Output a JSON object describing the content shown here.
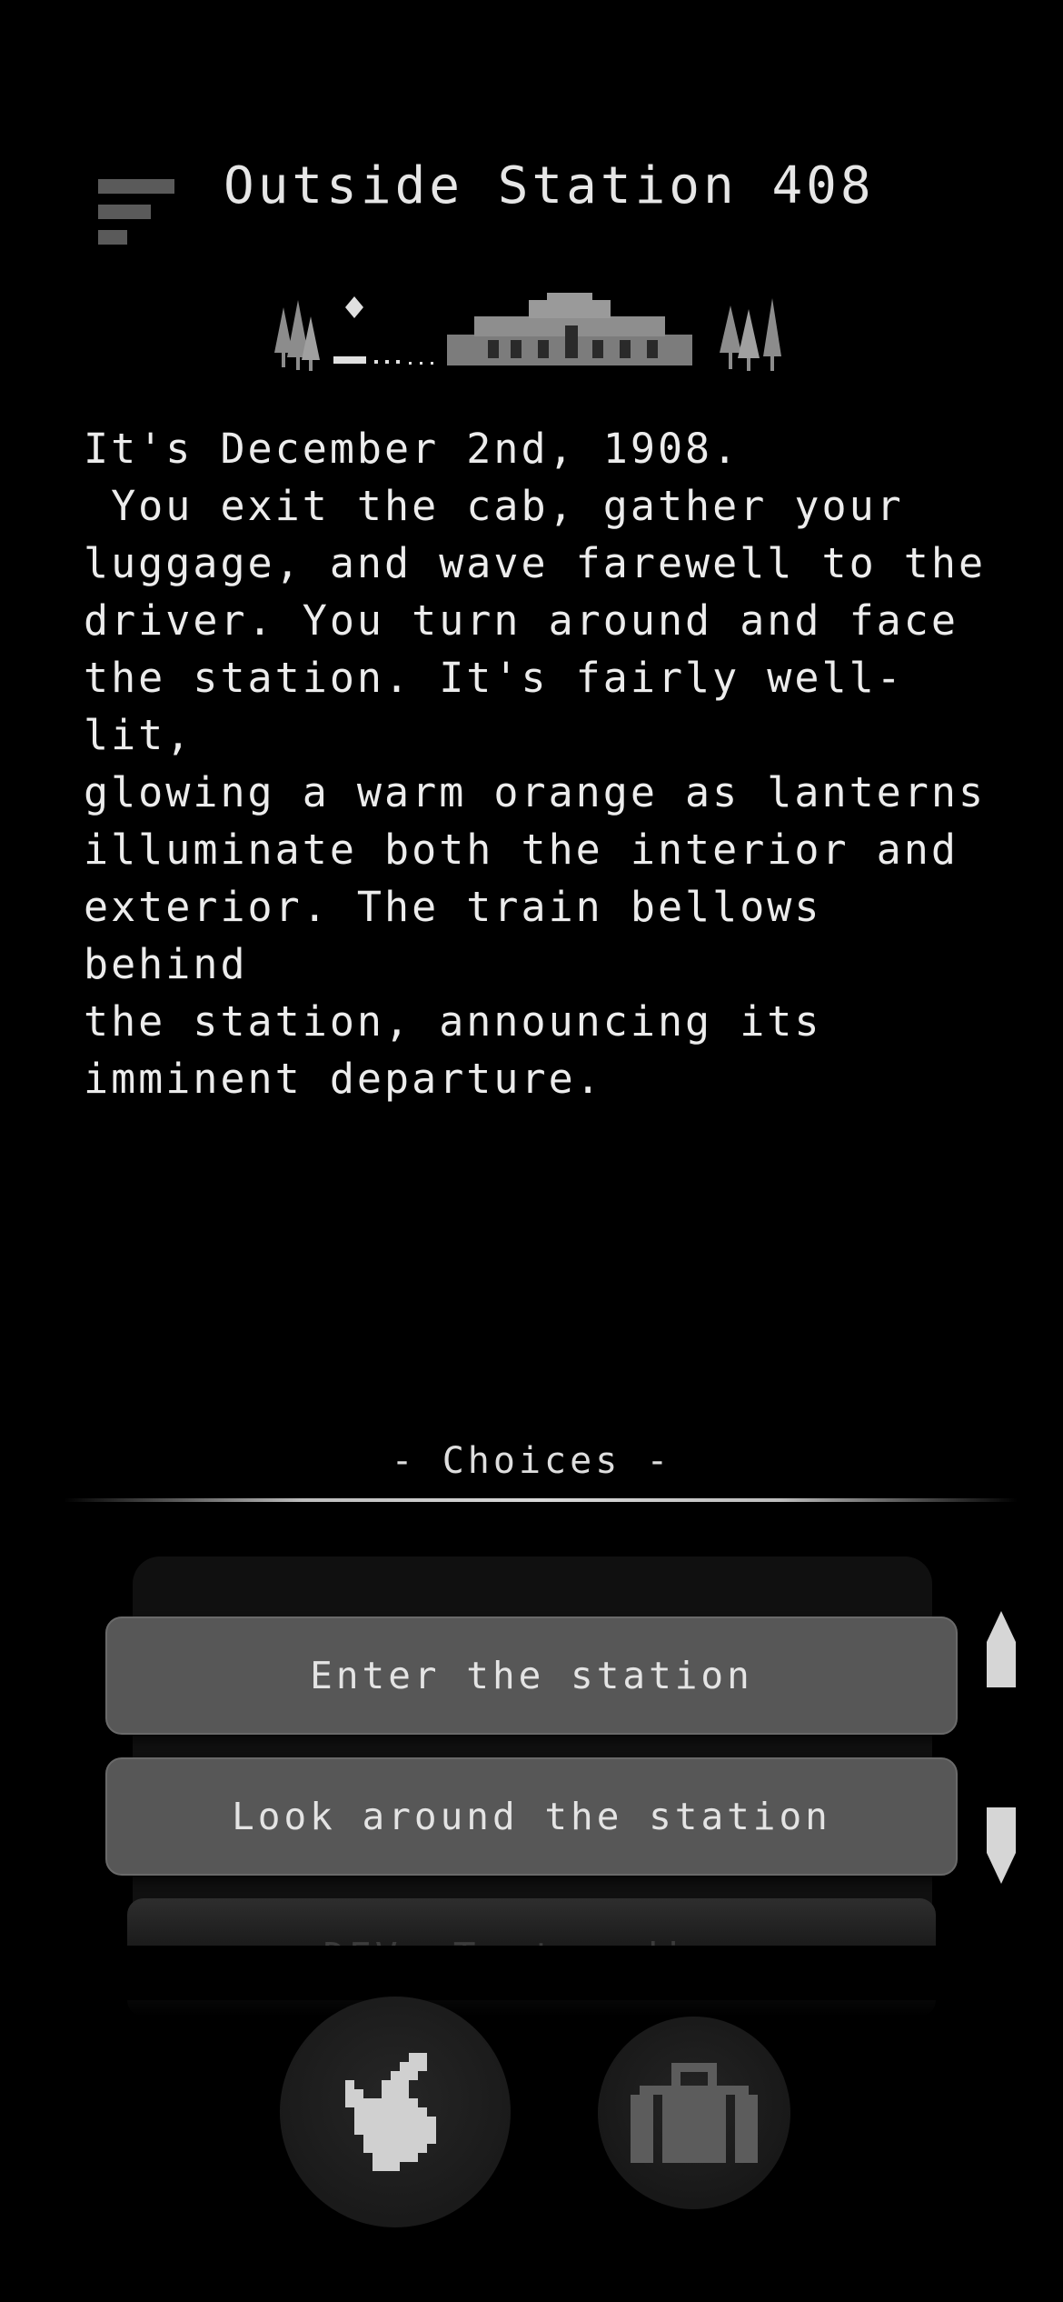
{
  "header": {
    "menu_icon": "menu-icon",
    "title": "Outside Station 408"
  },
  "scene": {
    "art_icon": "station-scene-pixel-art",
    "narrative": "It's December 2nd, 1908.\n You exit the cab, gather your\nluggage, and wave farewell to the\ndriver. You turn around and face\nthe station. It's fairly well-lit,\nglowing a warm orange as lanterns\nilluminate both the interior and\nexterior. The train bellows behind\nthe station, announcing its\nimminent departure."
  },
  "choices": {
    "heading": "- Choices -",
    "items": [
      {
        "label": "Enter the station"
      },
      {
        "label": "Look around the station"
      },
      {
        "label": "DEV: Test ending"
      }
    ],
    "scroll_up_icon": "arrow-up-icon",
    "scroll_down_icon": "arrow-down-icon"
  },
  "bottom_bar": {
    "action_icon": "hand-icon",
    "inventory_icon": "suitcase-icon"
  },
  "colors": {
    "background": "#000000",
    "text": "#e8e8e8",
    "choice_button": "#575757",
    "round_button": "#1c1c1c",
    "icon": "#d0d0d0",
    "menu_bars": "#5a5a5a"
  }
}
